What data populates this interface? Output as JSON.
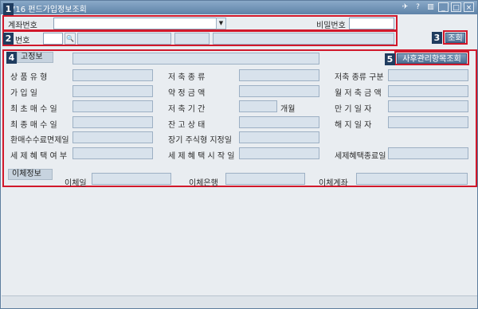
{
  "window": {
    "title": "716 펀드가입정보조회"
  },
  "titlebar_icons": [
    "pin-icon",
    "help-icon",
    "menu-icon",
    "minimize-icon",
    "maximize-icon",
    "close-icon"
  ],
  "titlebar_glyphs": {
    "pin": "✈",
    "help": "?",
    "menu": "▥",
    "minimize": "_",
    "maximize": "□",
    "close": "×"
  },
  "badges": {
    "b1": "1",
    "b2": "2",
    "b3": "3",
    "b4": "4",
    "b5": "5"
  },
  "row1": {
    "account_label": "계좌번호",
    "dropdown_arrow": "▼",
    "password_label": "비밀번호"
  },
  "row2": {
    "id_label": "번호",
    "search_glyph": "🔍"
  },
  "query_button": "조회",
  "section_balance": {
    "tab": "고정보",
    "after_service_button": "사후관리항목조회"
  },
  "left_labels": [
    "상 품 유 형",
    "가 입 일",
    "최 초 매 수 일",
    "최 종 매 수 일",
    "환매수수료면제일",
    "세 제 혜 택 여 부"
  ],
  "mid_labels": [
    "저 축 종 류",
    "약 정 금 액",
    "저 축 기 간",
    "잔 고 상 태",
    "장기 주식형 지정일",
    "세 제 혜 택 시 작 일"
  ],
  "period_unit": "개월",
  "right_labels": [
    "저축 종류 구분",
    "월 저 축 금 액",
    "만 기 일 자",
    "해 지 일 자",
    "",
    "세제혜택종료일"
  ],
  "transfer": {
    "tab": "이체정보",
    "date_label": "이체일",
    "bank_label": "이체은행",
    "account_label": "이체계좌"
  },
  "colors": {
    "accent_red": "#d1182b",
    "badge": "#1f3c5f",
    "title_bar": "#5e83a8"
  }
}
